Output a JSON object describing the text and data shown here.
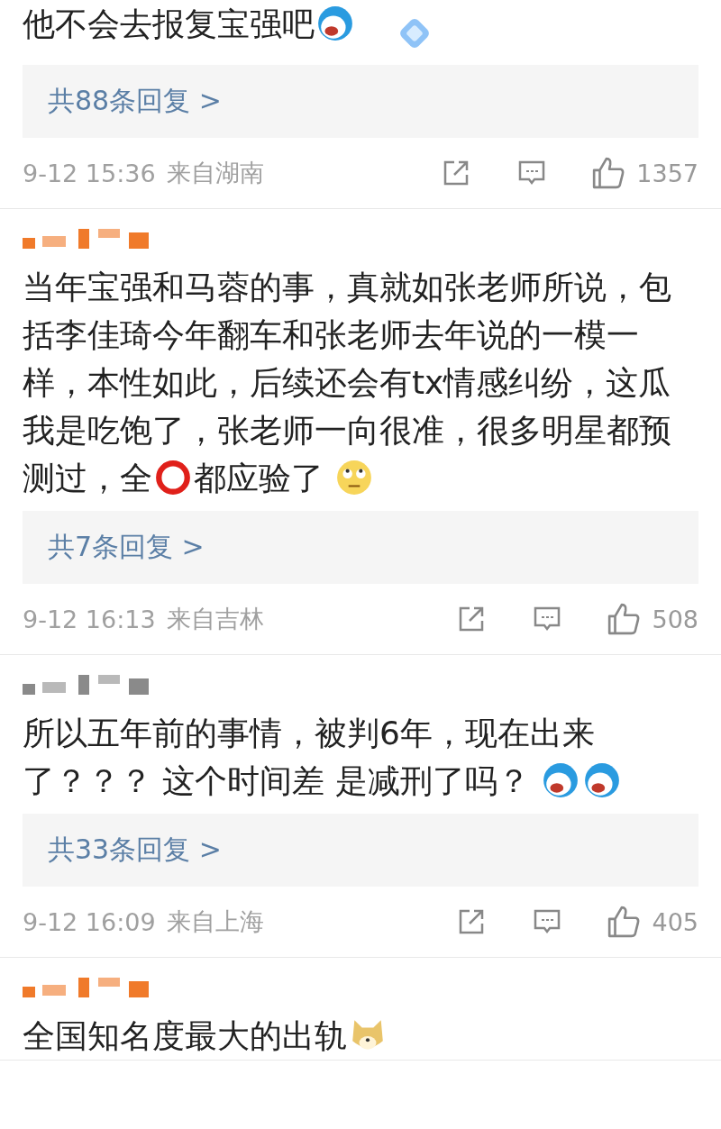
{
  "comments": [
    {
      "body": [
        {
          "kind": "text",
          "text": "他不会去报复宝强吧"
        },
        {
          "kind": "robot"
        }
      ],
      "badge": true,
      "replies": "共88条回复 >",
      "date": "9-12 15:36",
      "location": "来自湖南",
      "likes": "1357"
    },
    {
      "color": "#f07a2a",
      "body": [
        {
          "kind": "text",
          "text": "当年宝强和马蓉的事，真就如张老师所说，包括李佳琦今年翻车和张老师去年说的一模一样，本性如此，后续还会有tx情感纠纷，这瓜我是吃饱了，张老师一向很准，很多明星都预测过，全"
        },
        {
          "kind": "ring"
        },
        {
          "kind": "text",
          "text": "都应验了 "
        },
        {
          "kind": "eyeroll"
        }
      ],
      "badge": false,
      "replies": "共7条回复 >",
      "date": "9-12 16:13",
      "location": "来自吉林",
      "likes": "508"
    },
    {
      "color": "#8a8a8a",
      "body": [
        {
          "kind": "text",
          "text": "所以五年前的事情，被判6年，现在出来了？？？ 这个时间差 是减刑了吗？ "
        },
        {
          "kind": "robot"
        },
        {
          "kind": "robot"
        }
      ],
      "badge": false,
      "replies": "共33条回复 >",
      "date": "9-12 16:09",
      "location": "来自上海",
      "likes": "405"
    },
    {
      "color": "#f07a2a",
      "body": [
        {
          "kind": "text",
          "text": "全国知名度最大的出轨"
        },
        {
          "kind": "dog"
        }
      ],
      "badge": false
    }
  ]
}
